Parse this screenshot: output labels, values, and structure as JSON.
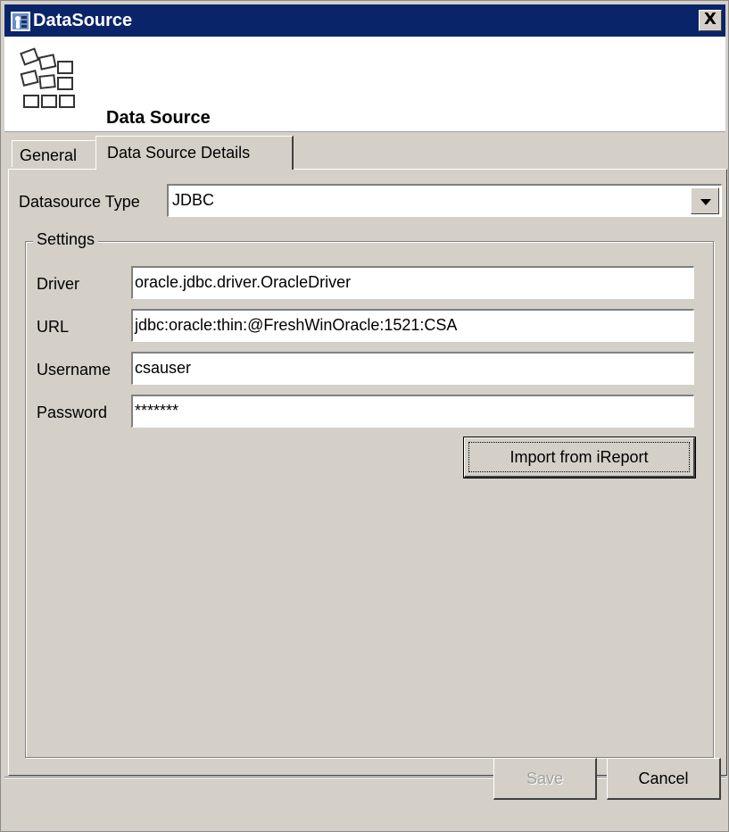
{
  "window": {
    "title": "DataSource",
    "close_label": "X"
  },
  "header": {
    "title": "Data Source",
    "icon": "datasource-grid-icon"
  },
  "tabs": [
    {
      "label": "General",
      "selected": false
    },
    {
      "label": "Data Source Details",
      "selected": true
    }
  ],
  "datasource_type": {
    "label": "Datasource Type",
    "value": "JDBC"
  },
  "settings": {
    "title": "Settings",
    "driver": {
      "label": "Driver",
      "value": "oracle.jdbc.driver.OracleDriver"
    },
    "url": {
      "label": "URL",
      "value": "jdbc:oracle:thin:@FreshWinOracle:1521:CSA"
    },
    "username": {
      "label": "Username",
      "value": "csauser"
    },
    "password": {
      "label": "Password",
      "value": "*******"
    },
    "import_button": "Import from iReport"
  },
  "footer": {
    "save_label": "Save",
    "save_enabled": false,
    "cancel_label": "Cancel"
  },
  "colors": {
    "titlebar": "#0a246a",
    "face": "#d4d0c8"
  }
}
